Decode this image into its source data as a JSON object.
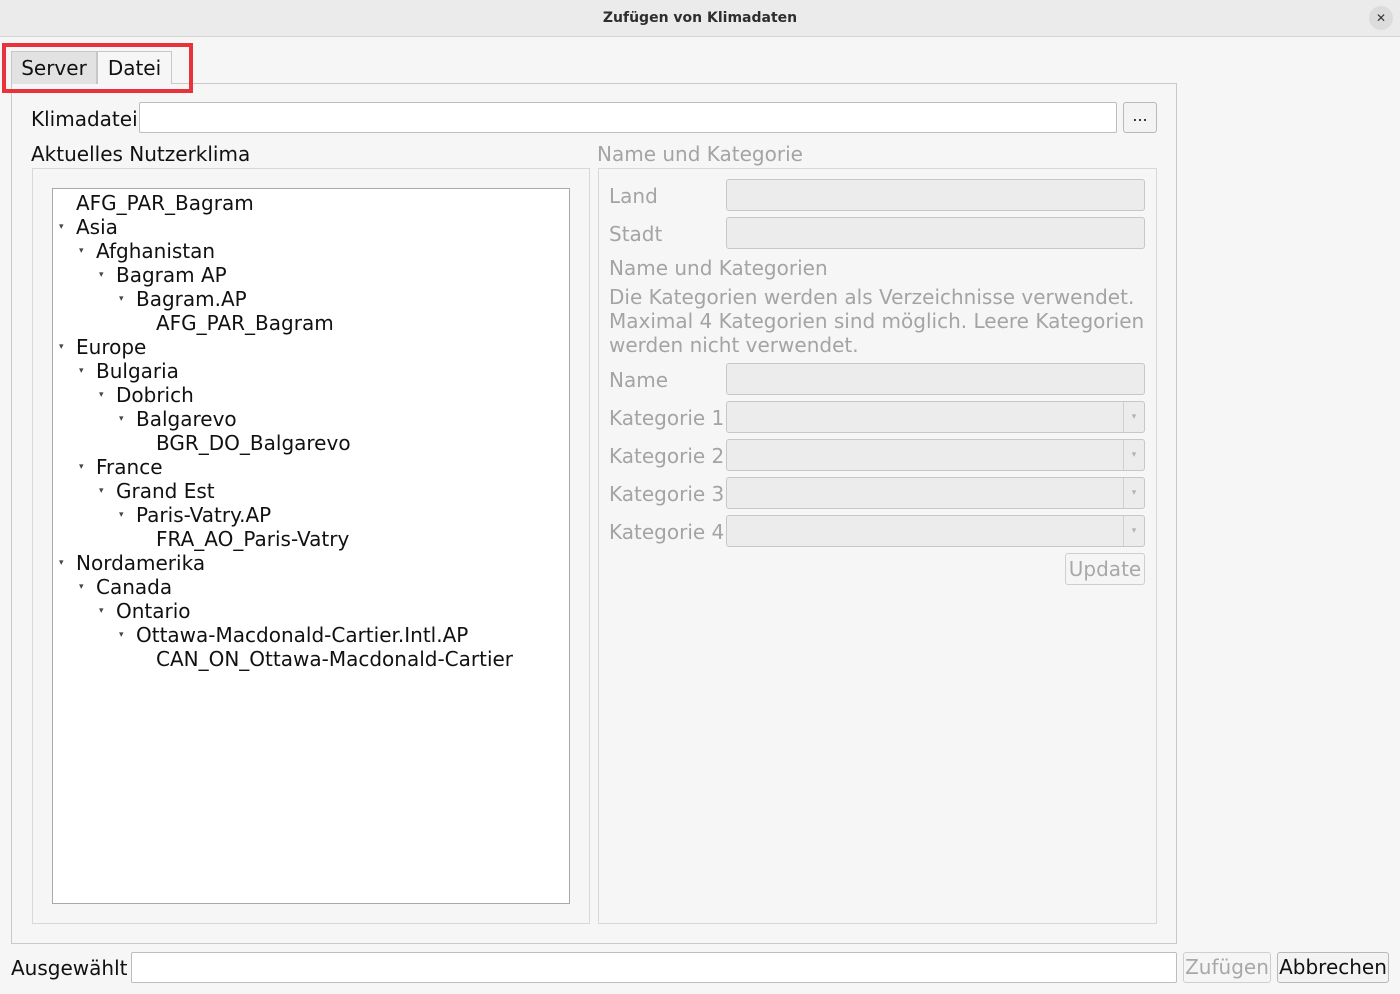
{
  "window": {
    "title": "Zufügen von Klimadaten",
    "close_glyph": "✕"
  },
  "tabs": [
    {
      "label": "Server"
    },
    {
      "label": "Datei"
    }
  ],
  "file": {
    "label": "Klimadatei",
    "value": "",
    "browse_label": "..."
  },
  "tree": {
    "header": "Aktuelles Nutzerklima",
    "items": [
      {
        "label": "AFG_PAR_Bagram",
        "level": 0,
        "expanded": false,
        "has_children": false
      },
      {
        "label": "Asia",
        "level": 0,
        "expanded": true,
        "has_children": true
      },
      {
        "label": "Afghanistan",
        "level": 1,
        "expanded": true,
        "has_children": true
      },
      {
        "label": "Bagram AP",
        "level": 2,
        "expanded": true,
        "has_children": true
      },
      {
        "label": "Bagram.AP",
        "level": 3,
        "expanded": true,
        "has_children": true
      },
      {
        "label": "AFG_PAR_Bagram",
        "level": 4,
        "expanded": false,
        "has_children": false
      },
      {
        "label": "Europe",
        "level": 0,
        "expanded": true,
        "has_children": true
      },
      {
        "label": "Bulgaria",
        "level": 1,
        "expanded": true,
        "has_children": true
      },
      {
        "label": "Dobrich",
        "level": 2,
        "expanded": true,
        "has_children": true
      },
      {
        "label": "Balgarevo",
        "level": 3,
        "expanded": true,
        "has_children": true
      },
      {
        "label": "BGR_DO_Balgarevo",
        "level": 4,
        "expanded": false,
        "has_children": false
      },
      {
        "label": "France",
        "level": 1,
        "expanded": true,
        "has_children": true
      },
      {
        "label": "Grand Est",
        "level": 2,
        "expanded": true,
        "has_children": true
      },
      {
        "label": "Paris-Vatry.AP",
        "level": 3,
        "expanded": true,
        "has_children": true
      },
      {
        "label": "FRA_AO_Paris-Vatry",
        "level": 4,
        "expanded": false,
        "has_children": false
      },
      {
        "label": "Nordamerika",
        "level": 0,
        "expanded": true,
        "has_children": true
      },
      {
        "label": "Canada",
        "level": 1,
        "expanded": true,
        "has_children": true
      },
      {
        "label": "Ontario",
        "level": 2,
        "expanded": true,
        "has_children": true
      },
      {
        "label": "Ottawa-Macdonald-Cartier.Intl.AP",
        "level": 3,
        "expanded": true,
        "has_children": true
      },
      {
        "label": "CAN_ON_Ottawa-Macdonald-Cartier",
        "level": 4,
        "expanded": false,
        "has_children": false
      }
    ]
  },
  "details": {
    "group_title": "Name und Kategorie",
    "land_label": "Land",
    "land_value": "",
    "stadt_label": "Stadt",
    "stadt_value": "",
    "section_title": "Name und Kategorien",
    "info_line1": "Die Kategorien werden als Verzeichnisse verwendet.",
    "info_line2": "Maximal 4 Kategorien sind möglich. Leere Kategorien",
    "info_line3": "werden nicht verwendet.",
    "name_label": "Name",
    "name_value": "",
    "kategorien": [
      {
        "label": "Kategorie 1",
        "value": ""
      },
      {
        "label": "Kategorie 2",
        "value": ""
      },
      {
        "label": "Kategorie 3",
        "value": ""
      },
      {
        "label": "Kategorie 4",
        "value": ""
      }
    ],
    "update_label": "Update"
  },
  "footer": {
    "selected_label": "Ausgewählt",
    "selected_value": "",
    "add_label": "Zufügen",
    "cancel_label": "Abbrechen"
  },
  "icons": {
    "expand_arrow": "▾",
    "combo_arrow": "▾"
  },
  "colors": {
    "highlight": "#e8323c",
    "disabled_text": "#a4a4a4"
  }
}
